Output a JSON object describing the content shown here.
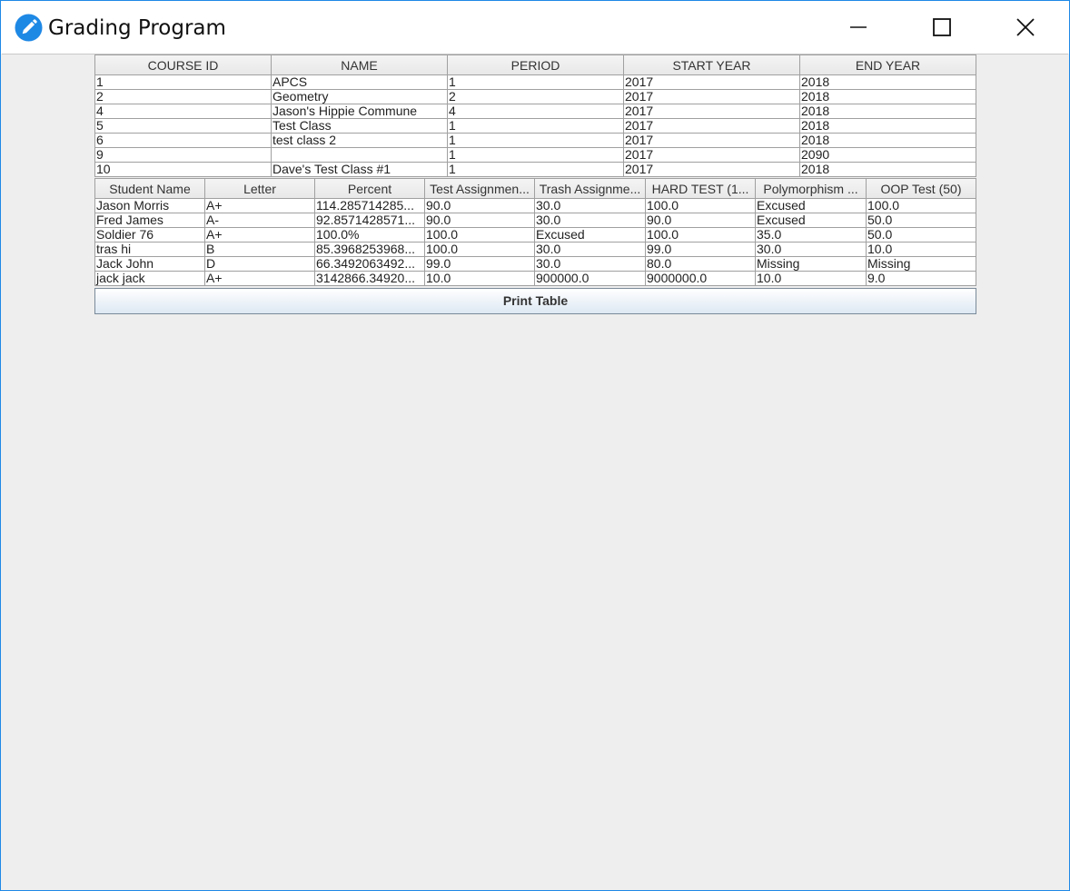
{
  "window": {
    "title": "Grading Program",
    "accent": "#1e88e5"
  },
  "courses": {
    "headers": [
      "COURSE ID",
      "NAME",
      "PERIOD",
      "START YEAR",
      "END YEAR"
    ],
    "rows": [
      [
        "1",
        "APCS",
        "1",
        "2017",
        "2018"
      ],
      [
        "2",
        "Geometry",
        "2",
        "2017",
        "2018"
      ],
      [
        "4",
        "Jason's Hippie Commune",
        "4",
        "2017",
        "2018"
      ],
      [
        "5",
        "Test Class",
        "1",
        "2017",
        "2018"
      ],
      [
        "6",
        "test class 2",
        "1",
        "2017",
        "2018"
      ],
      [
        "9",
        "",
        "1",
        "2017",
        "2090"
      ],
      [
        "10",
        "Dave's Test Class #1",
        "1",
        "2017",
        "2018"
      ]
    ]
  },
  "grades": {
    "headers": [
      "Student Name",
      "Letter",
      "Percent",
      "Test Assignmen...",
      "Trash Assignme...",
      "HARD TEST (1...",
      "Polymorphism ...",
      "OOP Test (50)"
    ],
    "rows": [
      [
        "Jason Morris",
        "A+",
        "114.285714285...",
        "90.0",
        "30.0",
        "100.0",
        "Excused",
        "100.0"
      ],
      [
        "Fred James",
        "A-",
        "92.8571428571...",
        "90.0",
        "30.0",
        "90.0",
        "Excused",
        "50.0"
      ],
      [
        "Soldier 76",
        "A+",
        "100.0%",
        "100.0",
        "Excused",
        "100.0",
        "35.0",
        "50.0"
      ],
      [
        "tras hi",
        "B",
        "85.3968253968...",
        "100.0",
        "30.0",
        "99.0",
        "30.0",
        "10.0"
      ],
      [
        "Jack John",
        "D",
        "66.3492063492...",
        "99.0",
        "30.0",
        "80.0",
        "Missing",
        "Missing"
      ],
      [
        "jack jack",
        "A+",
        "3142866.34920...",
        "10.0",
        "900000.0",
        "9000000.0",
        "10.0",
        "9.0"
      ]
    ]
  },
  "print_button": {
    "label": "Print Table"
  }
}
